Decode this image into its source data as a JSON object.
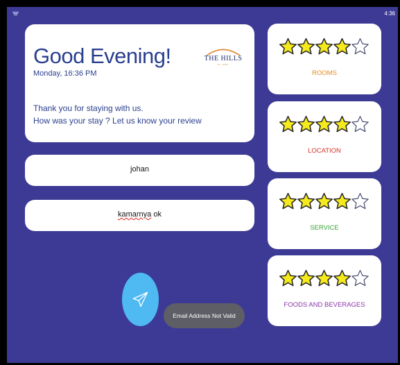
{
  "status_bar": {
    "time": "4:36",
    "left_icon": "hamburger-icon"
  },
  "greeting": {
    "title": "Good Evening!",
    "date": "Monday, 16:36 PM",
    "message_line1": "Thank you for staying with us.",
    "message_line2": "How was your stay ? Let us know your review"
  },
  "logo": {
    "text": "THE HILLS",
    "subtext": "DI ARA"
  },
  "form": {
    "name_value": "johan",
    "comment_word1": "kamarnya",
    "comment_word2": " ok"
  },
  "send_button": {
    "icon": "paper-plane-icon"
  },
  "toast": {
    "text": "Email Address Not Valid"
  },
  "ratings": [
    {
      "label": "ROOMS",
      "stars": 4,
      "max": 5,
      "color": "#e88a1a"
    },
    {
      "label": "LOCATION",
      "stars": 4,
      "max": 5,
      "color": "#d6332a"
    },
    {
      "label": "SERVICE",
      "stars": 4,
      "max": 5,
      "color": "#3aa53a"
    },
    {
      "label": "FOODS AND BEVERAGES",
      "stars": 4,
      "max": 5,
      "color": "#8a35a8"
    }
  ],
  "colors": {
    "background": "#3d3a96",
    "title": "#2a3f8f",
    "star_fill": "#f5ea1b",
    "star_outline": "#2a2a2a",
    "send_button": "#4fb9f1",
    "toast": "#5e5e66"
  }
}
